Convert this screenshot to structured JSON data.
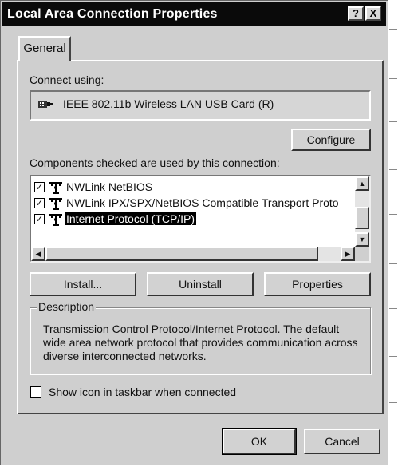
{
  "window": {
    "title": "Local Area Connection Properties",
    "help_button": "?",
    "close_button": "X"
  },
  "tabs": [
    {
      "label": "General",
      "selected": true
    }
  ],
  "connect_using": {
    "label": "Connect using:",
    "device": "IEEE 802.11b Wireless LAN USB Card (R)"
  },
  "configure_button": "Configure",
  "components": {
    "label": "Components checked are used by this connection:",
    "items": [
      {
        "label": "NWLink NetBIOS",
        "checked": true,
        "selected": false
      },
      {
        "label": "NWLink IPX/SPX/NetBIOS Compatible Transport Proto",
        "checked": true,
        "selected": false
      },
      {
        "label": "Internet Protocol (TCP/IP)",
        "checked": true,
        "selected": true
      }
    ]
  },
  "actions": {
    "install": "Install...",
    "uninstall": "Uninstall",
    "properties": "Properties"
  },
  "description": {
    "legend": "Description",
    "text": "Transmission Control Protocol/Internet Protocol. The default wide area network protocol that provides communication across diverse interconnected networks."
  },
  "taskbar_option": {
    "label": "Show icon in taskbar when connected",
    "checked": false
  },
  "dialog_buttons": {
    "ok": "OK",
    "cancel": "Cancel"
  },
  "icons": {
    "adapter": "network-adapter-icon",
    "protocol": "network-protocol-icon"
  },
  "colors": {
    "titlebar": "#0a0a0a",
    "face": "#cfcfcf",
    "selection": "#000000"
  }
}
